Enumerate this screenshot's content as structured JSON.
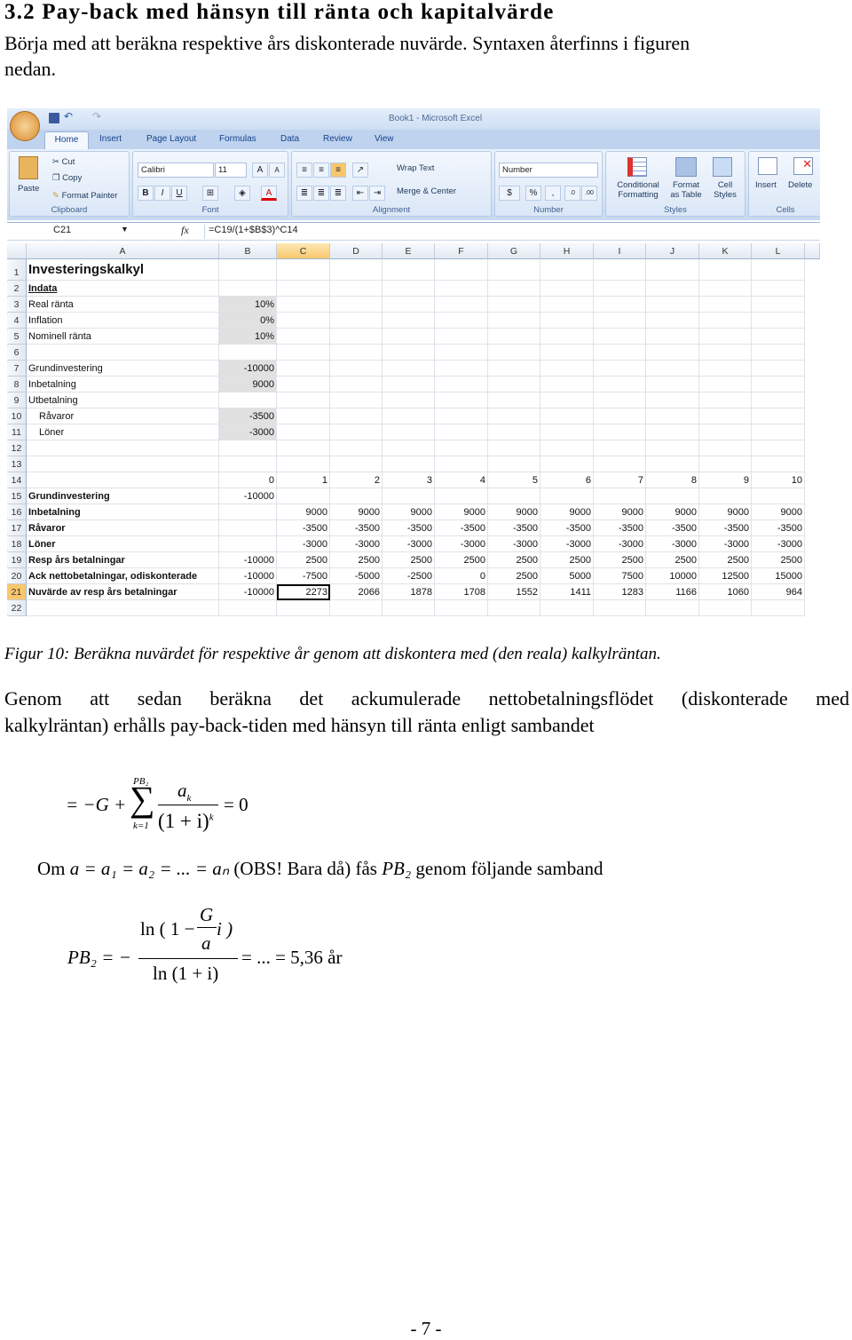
{
  "heading": "3.2 Pay-back med hänsyn till ränta och kapitalvärde",
  "intro": [
    "Börja med att beräkna respektive års diskonterade nuvärde. Syntaxen återfinns i figuren",
    "nedan."
  ],
  "excel": {
    "window_title": "Book1 - Microsoft Excel",
    "tabs": [
      "Home",
      "Insert",
      "Page Layout",
      "Formulas",
      "Data",
      "Review",
      "View"
    ],
    "clipboard": {
      "paste": "Paste",
      "cut": "Cut",
      "copy": "Copy",
      "format_painter": "Format Painter",
      "label": "Clipboard"
    },
    "font": {
      "name": "Calibri",
      "size": "11",
      "label": "Font",
      "bold": "B",
      "italic": "I",
      "underline": "U"
    },
    "alignment": {
      "wrap": "Wrap Text",
      "merge": "Merge & Center",
      "label": "Alignment"
    },
    "number": {
      "format": "Number",
      "percent": "%",
      "comma": ",",
      "label": "Number"
    },
    "styles": {
      "conditional": [
        "Conditional",
        "Formatting"
      ],
      "table": [
        "Format",
        "as Table"
      ],
      "cell": [
        "Cell",
        "Styles"
      ],
      "label": "Styles"
    },
    "cells": {
      "insert": "Insert",
      "delete": "Delete",
      "label": "Cells"
    },
    "name_box": "C21",
    "formula": "=C19/(1+$B$3)^C14",
    "fx": "fx",
    "columns": [
      "A",
      "B",
      "C",
      "D",
      "E",
      "F",
      "G",
      "H",
      "I",
      "J",
      "K",
      "L"
    ],
    "selected_cell": "C21",
    "rows": [
      [
        "Investeringskalkyl",
        "",
        "",
        "",
        "",
        "",
        "",
        "",
        "",
        "",
        "",
        ""
      ],
      [
        "Indata",
        "",
        "",
        "",
        "",
        "",
        "",
        "",
        "",
        "",
        "",
        ""
      ],
      [
        "Real ränta",
        "10%",
        "",
        "",
        "",
        "",
        "",
        "",
        "",
        "",
        "",
        ""
      ],
      [
        "Inflation",
        "0%",
        "",
        "",
        "",
        "",
        "",
        "",
        "",
        "",
        "",
        ""
      ],
      [
        "Nominell ränta",
        "10%",
        "",
        "",
        "",
        "",
        "",
        "",
        "",
        "",
        "",
        ""
      ],
      [
        "",
        "",
        "",
        "",
        "",
        "",
        "",
        "",
        "",
        "",
        "",
        ""
      ],
      [
        "Grundinvestering",
        "-10000",
        "",
        "",
        "",
        "",
        "",
        "",
        "",
        "",
        "",
        ""
      ],
      [
        "Inbetalning",
        "9000",
        "",
        "",
        "",
        "",
        "",
        "",
        "",
        "",
        "",
        ""
      ],
      [
        "Utbetalning",
        "",
        "",
        "",
        "",
        "",
        "",
        "",
        "",
        "",
        "",
        ""
      ],
      [
        "Råvaror",
        "-3500",
        "",
        "",
        "",
        "",
        "",
        "",
        "",
        "",
        "",
        ""
      ],
      [
        "Löner",
        "-3000",
        "",
        "",
        "",
        "",
        "",
        "",
        "",
        "",
        "",
        ""
      ],
      [
        "",
        "",
        "",
        "",
        "",
        "",
        "",
        "",
        "",
        "",
        "",
        ""
      ],
      [
        "",
        "",
        "",
        "",
        "",
        "",
        "",
        "",
        "",
        "",
        "",
        ""
      ],
      [
        "",
        "0",
        "1",
        "2",
        "3",
        "4",
        "5",
        "6",
        "7",
        "8",
        "9",
        "10"
      ],
      [
        "Grundinvestering",
        "-10000",
        "",
        "",
        "",
        "",
        "",
        "",
        "",
        "",
        "",
        ""
      ],
      [
        "Inbetalning",
        "",
        "9000",
        "9000",
        "9000",
        "9000",
        "9000",
        "9000",
        "9000",
        "9000",
        "9000",
        "9000"
      ],
      [
        "Råvaror",
        "",
        "-3500",
        "-3500",
        "-3500",
        "-3500",
        "-3500",
        "-3500",
        "-3500",
        "-3500",
        "-3500",
        "-3500"
      ],
      [
        "Löner",
        "",
        "-3000",
        "-3000",
        "-3000",
        "-3000",
        "-3000",
        "-3000",
        "-3000",
        "-3000",
        "-3000",
        "-3000"
      ],
      [
        "Resp års betalningar",
        "-10000",
        "2500",
        "2500",
        "2500",
        "2500",
        "2500",
        "2500",
        "2500",
        "2500",
        "2500",
        "2500"
      ],
      [
        "Ack nettobetalningar, odiskonterade",
        "-10000",
        "-7500",
        "-5000",
        "-2500",
        "0",
        "2500",
        "5000",
        "7500",
        "10000",
        "12500",
        "15000"
      ],
      [
        "Nuvärde av resp års betalningar",
        "-10000",
        "2273",
        "2066",
        "1878",
        "1708",
        "1552",
        "1411",
        "1283",
        "1166",
        "1060",
        "964"
      ],
      [
        "",
        "",
        "",
        "",
        "",
        "",
        "",
        "",
        "",
        "",
        "",
        ""
      ]
    ]
  },
  "caption": "Figur 10: Beräkna nuvärdet för respektive år genom att diskontera med (den reala) kalkylräntan.",
  "paragraph": [
    "Genom att sedan beräkna det ackumulerade nettobetalningsflödet (diskonterade med",
    "kalkylräntan) erhålls pay-back-tiden med hänsyn till ränta enligt sambandet"
  ],
  "eq1": {
    "lhs": "= −G +",
    "sum_top": "PB₂",
    "sum_bot": "k=1",
    "num": "a",
    "num_sub": "k",
    "den": "(1 + i)",
    "den_sup": "k",
    "rhs": "= 0"
  },
  "condition": {
    "om": "Om",
    "expr": "a = a₁ = a₂ = ... = aₙ",
    "obs": "(OBS! Bara då) fås",
    "pb": "PB₂",
    "rest": "genom följande samband"
  },
  "eq2": {
    "lhs": "PB₂ = −",
    "num": "ln ( 1 − ",
    "G": "G",
    "a": "a",
    "i": "i )",
    "den": "ln (1 + i)",
    "rhs": "= ... = 5,36 år"
  },
  "page_number": "- 7 -"
}
